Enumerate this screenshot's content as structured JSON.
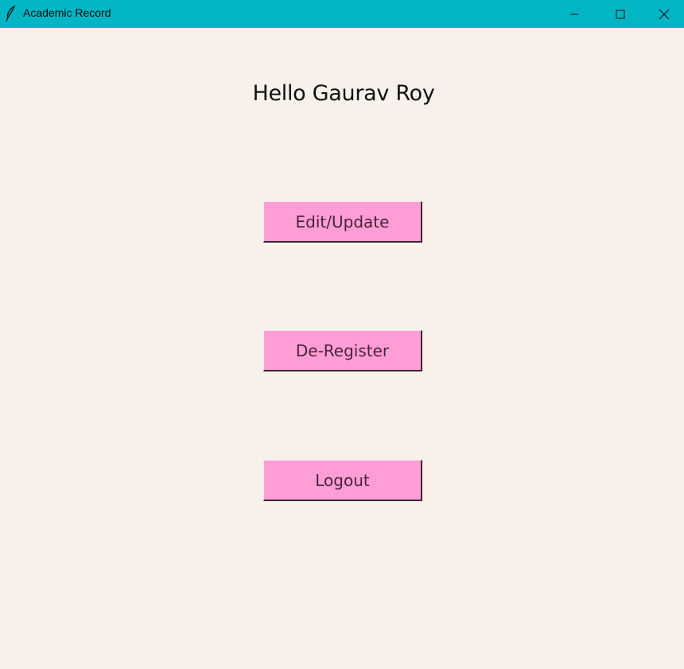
{
  "window": {
    "title": "Academic Record",
    "titlebar_color": "#00b5c4",
    "background_color": "#f8f1ea",
    "controls": [
      "minimize-icon",
      "maximize-icon",
      "close-icon"
    ]
  },
  "main": {
    "greeting": "Hello Gaurav Roy",
    "button_color": "#ff9dd6",
    "buttons": {
      "edit_update": "Edit/Update",
      "deregister": "De-Register",
      "logout": "Logout"
    }
  }
}
